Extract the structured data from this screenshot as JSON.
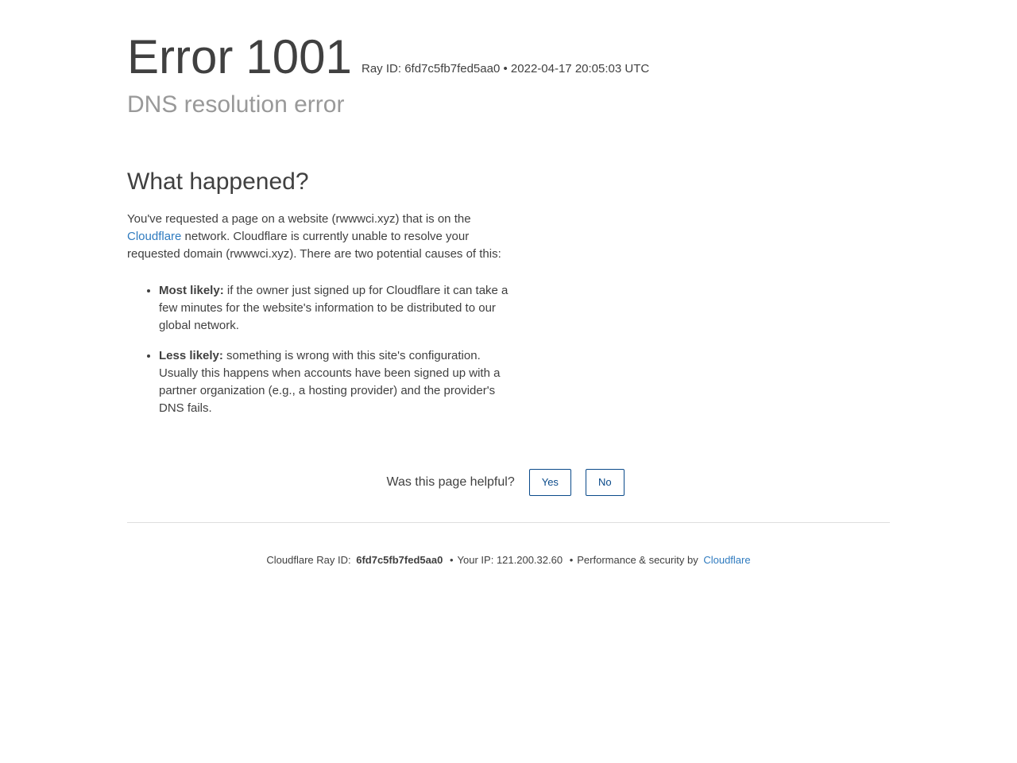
{
  "header": {
    "error_word": "Error",
    "error_code": "1001",
    "ray_id_label": "Ray ID:",
    "ray_id_value": "6fd7c5fb7fed5aa0",
    "bullet": "•",
    "timestamp": "2022-04-17 20:05:03 UTC",
    "subtitle": "DNS resolution error"
  },
  "main": {
    "heading": "What happened?",
    "intro_part1": "You've requested a page on a website (rwwwci.xyz) that is on the ",
    "intro_link": "Cloudflare",
    "intro_part2": " network. Cloudflare is currently unable to resolve your requested domain (rwwwci.xyz). There are two potential causes of this:",
    "causes": [
      {
        "label": "Most likely:",
        "text": " if the owner just signed up for Cloudflare it can take a few minutes for the website's information to be distributed to our global network."
      },
      {
        "label": "Less likely:",
        "text": " something is wrong with this site's configuration. Usually this happens when accounts have been signed up with a partner organization (e.g., a hosting provider) and the provider's DNS fails."
      }
    ]
  },
  "feedback": {
    "question": "Was this page helpful?",
    "yes_label": "Yes",
    "no_label": "No"
  },
  "footer": {
    "ray_label": "Cloudflare Ray ID:",
    "ray_value": "6fd7c5fb7fed5aa0",
    "bullet": "•",
    "ip_label": "Your IP:",
    "ip_value": "121.200.32.60",
    "perf_label": "Performance & security by",
    "cf_link": "Cloudflare"
  },
  "colors": {
    "text": "#404040",
    "muted": "#999999",
    "link": "#2f7bbf",
    "button_border": "#0a4a8a",
    "divider": "#dedede"
  }
}
